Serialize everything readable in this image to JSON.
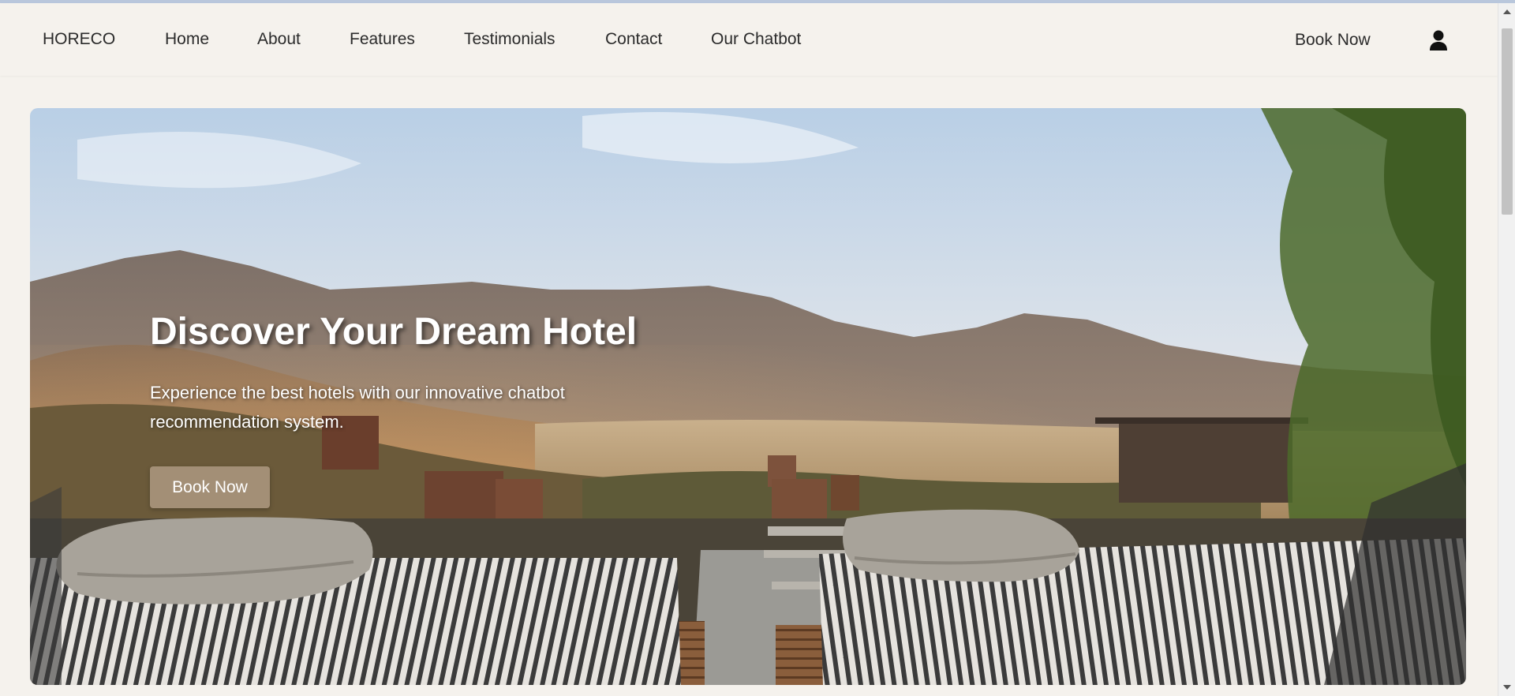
{
  "nav": {
    "brand": "HORECO",
    "links": [
      "Home",
      "About",
      "Features",
      "Testimonials",
      "Contact",
      "Our Chatbot"
    ],
    "book_now": "Book Now",
    "user_icon": "user-icon"
  },
  "hero": {
    "title": "Discover Your Dream Hotel",
    "subtitle": "Experience the best hotels with our innovative chatbot recommendation system.",
    "button_label": "Book Now"
  },
  "colors": {
    "page_bg": "#f5f2ed",
    "button_bg": "#a38f76",
    "text": "#2b2b2b"
  }
}
